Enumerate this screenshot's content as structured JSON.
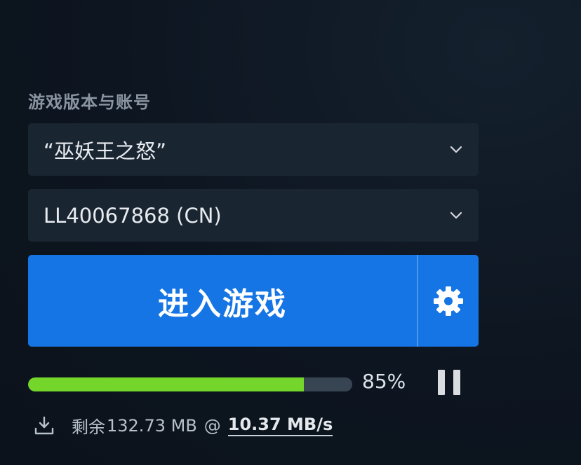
{
  "section_label": "游戏版本与账号",
  "version_select": {
    "value": "“巫妖王之怒”"
  },
  "account_select": {
    "value": "LL40067868 (CN)"
  },
  "play_button": {
    "label": "进入游戏"
  },
  "download": {
    "progress_fraction": 0.85,
    "percent_label": "85%",
    "remaining_prefix": "剩余",
    "remaining_size": "132.73 MB",
    "at": "@",
    "speed": "10.37 MB/s"
  },
  "icons": {
    "chevron": "chevron-down-icon",
    "settings": "gear-icon",
    "pause": "pause-icon",
    "download": "download-icon"
  },
  "colors": {
    "accent": "#1575e4",
    "progress": "#74d62a",
    "track": "#374552",
    "select_bg": "#1a2532",
    "background": "#0d1520"
  }
}
